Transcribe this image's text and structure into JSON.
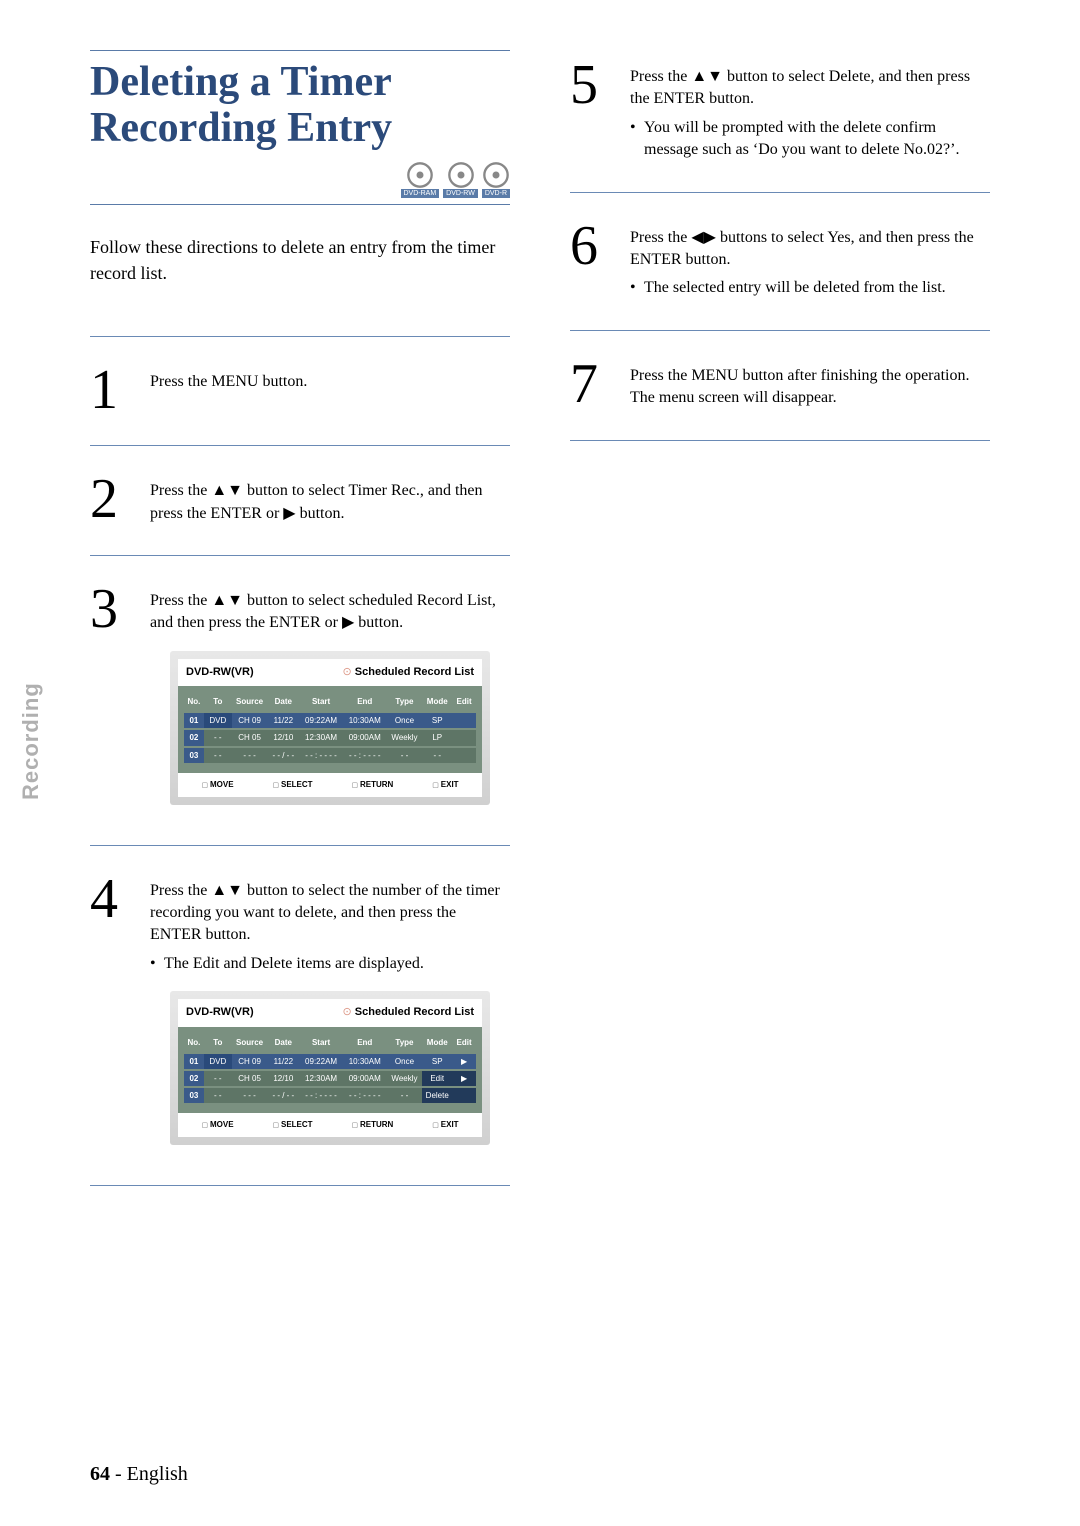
{
  "sidebar_label": "Recording",
  "title": "Deleting a Timer Recording Entry",
  "disc_labels": [
    "DVD-RAM",
    "DVD-RW",
    "DVD-R"
  ],
  "intro": "Follow these directions to delete an entry from the timer record list.",
  "steps_left": [
    {
      "num": "1",
      "text": "Press the MENU button."
    },
    {
      "num": "2",
      "text": "Press the ▲▼ button to select Timer Rec., and then press the ENTER or ▶ button."
    },
    {
      "num": "3",
      "text": "Press the ▲▼ button to select scheduled Record List, and then press the ENTER or ▶ button."
    },
    {
      "num": "4",
      "text": "Press the ▲▼ button to select the number of the timer recording you want to delete, and then press the ENTER button.",
      "bullet": "The Edit and Delete items are displayed."
    }
  ],
  "steps_right": [
    {
      "num": "5",
      "text": "Press the ▲▼ button to select Delete, and then press the ENTER button.",
      "bullet": "You will be prompted with the delete confirm message such as ‘Do you want to delete No.02?’."
    },
    {
      "num": "6",
      "text": "Press the ◀▶ buttons to select Yes, and then press the ENTER button.",
      "bullet": "The selected entry will be deleted from the list."
    },
    {
      "num": "7",
      "text": "Press the MENU button after finishing the operation. The menu screen will disappear."
    }
  ],
  "osd1": {
    "title_left": "DVD-RW(VR)",
    "title_right": "Scheduled Record List",
    "headers": [
      "No.",
      "To",
      "Source",
      "Date",
      "Start",
      "End",
      "Type",
      "Mode",
      "Edit"
    ],
    "rows": [
      {
        "no": "01",
        "to": "DVD",
        "src": "CH 09",
        "date": "11/22",
        "start": "09:22AM",
        "end": "10:30AM",
        "type": "Once",
        "mode": "SP",
        "edit": "",
        "sel": true
      },
      {
        "no": "02",
        "to": "- -",
        "src": "CH 05",
        "date": "12/10",
        "start": "12:30AM",
        "end": "09:00AM",
        "type": "Weekly",
        "mode": "LP",
        "edit": ""
      },
      {
        "no": "03",
        "to": "- -",
        "src": "- - -",
        "date": "- - / - -",
        "start": "- - : - - - -",
        "end": "- - : - - - -",
        "type": "- -",
        "mode": "- -",
        "edit": ""
      }
    ],
    "footer": [
      "MOVE",
      "SELECT",
      "RETURN",
      "EXIT"
    ]
  },
  "osd2": {
    "title_left": "DVD-RW(VR)",
    "title_right": "Scheduled Record List",
    "headers": [
      "No.",
      "To",
      "Source",
      "Date",
      "Start",
      "End",
      "Type",
      "Mode",
      "Edit"
    ],
    "rows": [
      {
        "no": "01",
        "to": "DVD",
        "src": "CH 09",
        "date": "11/22",
        "start": "09:22AM",
        "end": "10:30AM",
        "type": "Once",
        "mode": "SP",
        "edit": "▶",
        "sel": true
      },
      {
        "no": "02",
        "to": "- -",
        "src": "CH 05",
        "date": "12/10",
        "start": "12:30AM",
        "end": "09:00AM",
        "type": "Weekly",
        "mode": "Edit",
        "edit": "▶",
        "editbtn": true
      },
      {
        "no": "03",
        "to": "- -",
        "src": "- - -",
        "date": "- - / - -",
        "start": "- - : - - - -",
        "end": "- - : - - - -",
        "type": "- -",
        "mode": "Delete",
        "edit": "",
        "editbtn": true
      }
    ],
    "footer": [
      "MOVE",
      "SELECT",
      "RETURN",
      "EXIT"
    ]
  },
  "footer": {
    "page": "64",
    "sep": " - ",
    "lang": "English"
  }
}
